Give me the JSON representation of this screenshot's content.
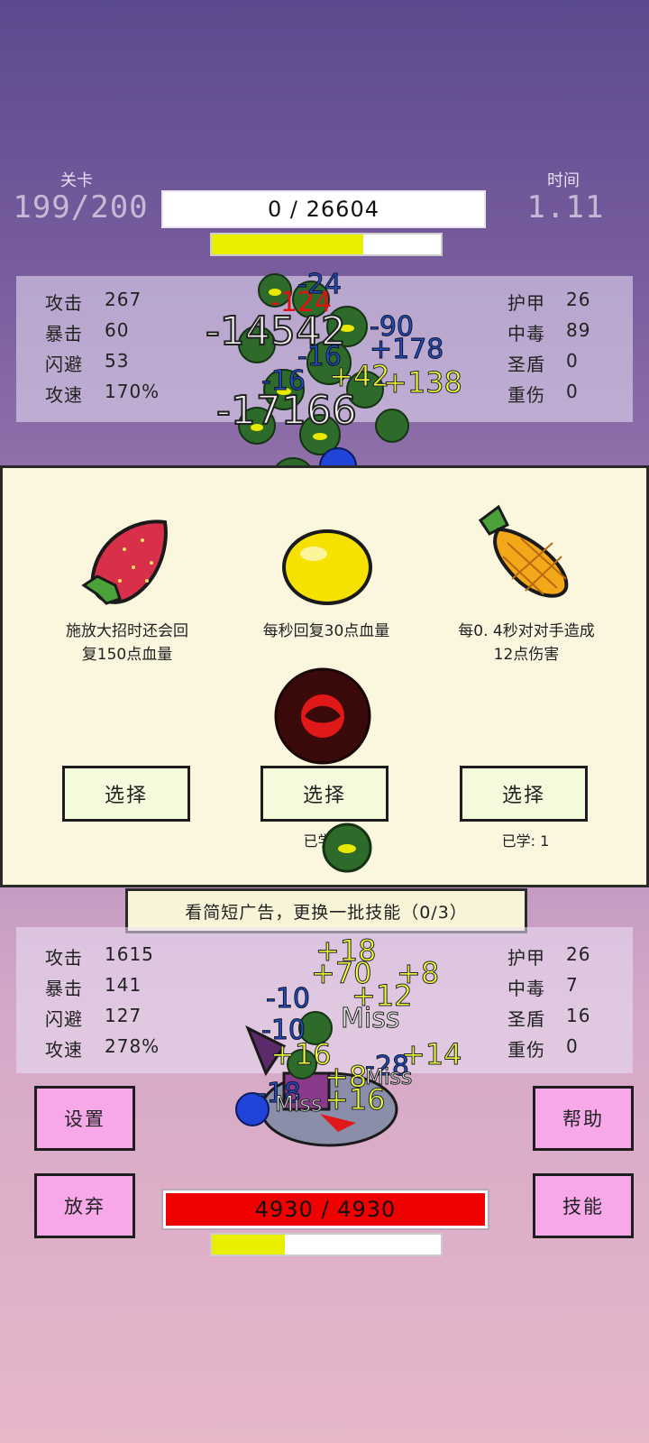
{
  "header": {
    "level_label": "关卡",
    "level_value": "199/200",
    "time_label": "时间",
    "time_value": "1.11",
    "enemy_hp": "0  /  26604",
    "enemy_energy_fraction": 0.66
  },
  "enemy_stats": {
    "attack_label": "攻击",
    "attack": "267",
    "crit_label": "暴击",
    "crit": "60",
    "dodge_label": "闪避",
    "dodge": "53",
    "speed_label": "攻速",
    "speed": "170%",
    "armor_label": "护甲",
    "armor": "26",
    "poison_label": "中毒",
    "poison": "89",
    "shield_label": "圣盾",
    "shield": "0",
    "wound_label": "重伤",
    "wound": "0"
  },
  "skills": [
    {
      "fruit": "strawberry-icon",
      "desc1": "施放大招时还会回",
      "desc2": "复150点血量",
      "button": "选择",
      "learned": ""
    },
    {
      "fruit": "lemon-icon",
      "desc1": "每秒回复30点血量",
      "desc2": "",
      "button": "选择",
      "learned": "已学: 1"
    },
    {
      "fruit": "pineapple-icon",
      "desc1": "每0. 4秒对对手造成",
      "desc2": "12点伤害",
      "button": "选择",
      "learned": "已学: 1"
    }
  ],
  "ad_button": "看简短广告，更换一批技能（0/3）",
  "player_stats": {
    "attack_label": "攻击",
    "attack": "1615",
    "crit_label": "暴击",
    "crit": "141",
    "dodge_label": "闪避",
    "dodge": "127",
    "speed_label": "攻速",
    "speed": "278%",
    "armor_label": "护甲",
    "armor": "26",
    "poison_label": "中毒",
    "poison": "7",
    "shield_label": "圣盾",
    "shield": "16",
    "wound_label": "重伤",
    "wound": "0"
  },
  "buttons": {
    "settings": "设置",
    "help": "帮助",
    "give_up": "放弃",
    "skills": "技能"
  },
  "player_hp": "4930  /  4930",
  "player_energy_fraction": 0.32,
  "floating_numbers": {
    "big1": "-14542",
    "big2": "-17166",
    "t1": "-90",
    "t2": "+178",
    "t3": "+42",
    "t4": "+138",
    "t5": "-16",
    "t6": "-16",
    "t7": "-24",
    "t8": "-124",
    "b1": "+18",
    "b2": "+70",
    "b3": "+8",
    "b4": "-10",
    "b5": "+12",
    "b6": "Miss",
    "b7": "-10",
    "b8": "+16",
    "b9": "+14",
    "b10": "+8",
    "b11": "-28",
    "b12": "-18",
    "b13": "+16",
    "b14": "Miss",
    "b15": "Miss"
  },
  "colors": {
    "enemy_hp_bar": "#ffffff",
    "player_hp_bar": "#f00000",
    "energy": "#e8f000",
    "pink_button": "#f6a8e8",
    "skill_panel": "#fbf7df"
  }
}
